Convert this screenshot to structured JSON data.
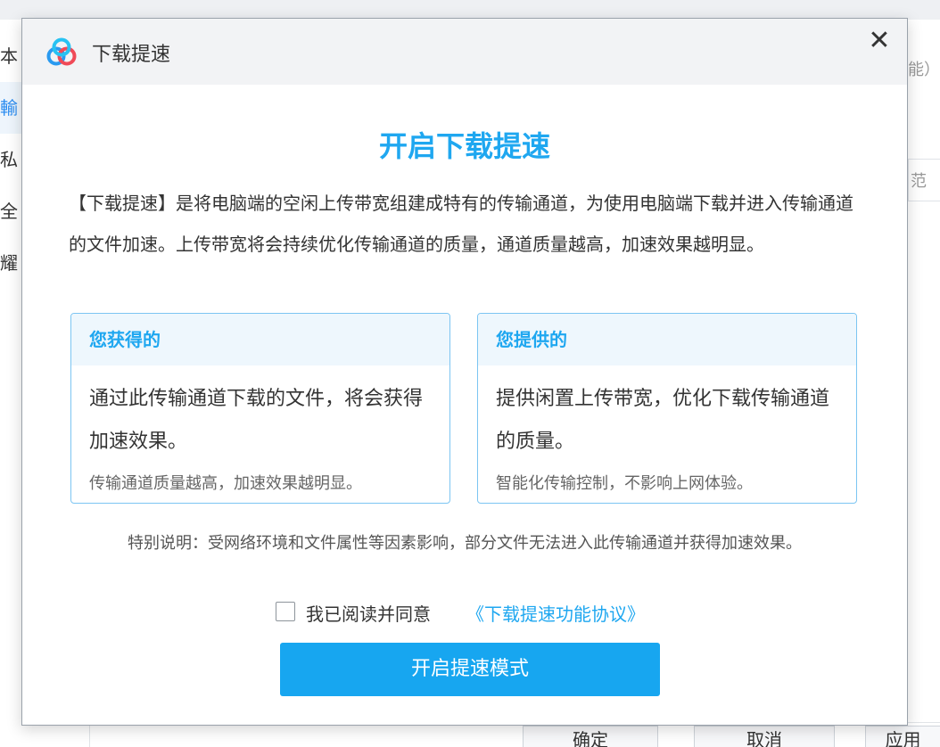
{
  "background": {
    "left_nav": [
      {
        "label": "本",
        "active": false
      },
      {
        "label": "輸",
        "active": true
      },
      {
        "label": "私",
        "active": false
      },
      {
        "label": "全",
        "active": false
      },
      {
        "label": "耀",
        "active": false
      }
    ],
    "right_text": "能）",
    "right_field_text": "范",
    "confirm_button": "确定",
    "cancel_button": "取消",
    "apply_button": "应用"
  },
  "dialog": {
    "title": "下载提速",
    "logo_icon": "baidu-netdisk-cloud-icon",
    "close_symbol": "✕",
    "main_title": "开启下载提速",
    "intro": "【下载提速】是将电脑端的空闲上传带宽组建成特有的传输通道，为使用电脑端下载并进入传输通道的文件加速。上传带宽将会持续优化传输通道的质量，通道质量越高，加速效果越明显。",
    "cards": [
      {
        "title": "您获得的",
        "body": "通过此传输通道下载的文件，将会获得加速效果。",
        "note": "传输通道质量越高，加速效果越明显。"
      },
      {
        "title": "您提供的",
        "body": "提供闲置上传带宽，优化下载传输通道的质量。",
        "note": "智能化传输控制，不影响上网体验。"
      }
    ],
    "special_note": "特别说明：受网络环境和文件属性等因素影响，部分文件无法进入此传输通道并获得加速效果。",
    "agree": {
      "checked": false,
      "text": "我已阅读并同意",
      "link": "《下载提速功能协议》"
    },
    "primary_button": "开启提速模式"
  },
  "colors": {
    "accent": "#1fa7f0",
    "button": "#17a6f0",
    "card_border": "#7cc5f2",
    "card_header_bg": "#eef7fd",
    "header_bg": "#f2f3f5"
  }
}
